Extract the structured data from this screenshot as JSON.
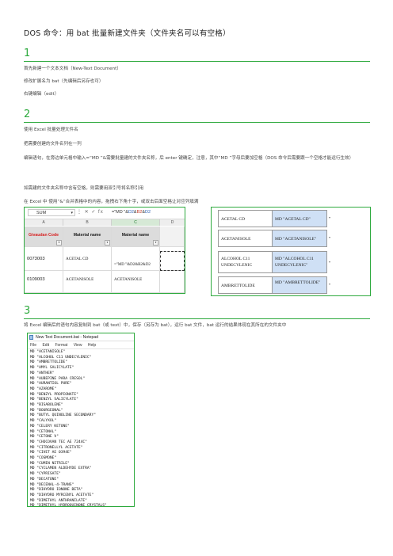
{
  "title": "DOS 命令：用 bat 批量新建文件夹（文件夹名可以有空格）",
  "sections": [
    {
      "num": "1",
      "lines": [
        "首先新建一个文本文档（New-Text Document）",
        "修改扩展名为 bat（先编辑后另存也可）",
        "右键编辑（edit）"
      ]
    },
    {
      "num": "2",
      "lines": [
        "使用 Excel 批量处理文件名",
        "把需要创建的文件名列在一列",
        "编辑语句，在旁边单元格中输入=“MD ”&需要批量建的文件夹名称，后 enter 键确定，注意，其中“MD ”字母后要加空格（DOS 命令后需要跟一个空格才能运行生效）",
        "如需建的文件夹名称中含有空格，则需要用双引号将名称引用",
        "在 Excel 中 使用“&”合并表格中的内容，拖拽右下角十字，或双击后面空格让对应列填满"
      ]
    },
    {
      "num": "3",
      "lines": [
        "将 Excel 编辑后的语句内容复制到 bat（或 text）中，保存（另存为 bat），运行 bat 文件，bat 运行的结果体现在其所在的文件夹中"
      ]
    }
  ],
  "excel": {
    "namebox": "SUM",
    "fx_icons": "⋮  ✕  ✓  fx",
    "formula_prefix": "=\"MD \"&",
    "formula_ref1": "D2",
    "formula_amp1": "&",
    "formula_ref2": "B2",
    "formula_amp2": "&",
    "formula_ref3": "D2",
    "col_headers": [
      "A",
      "B",
      "C",
      "D"
    ],
    "header_row": [
      "Givaudan Code",
      "Material name",
      "Material name",
      ""
    ],
    "rows": [
      [
        "0073003",
        "ACETAL CD",
        "",
        "=\"MD \"&D2&B2&D2"
      ],
      [
        "0109003",
        "ACETANISOLE",
        "ACETANISOLE",
        ""
      ]
    ]
  },
  "result_table": {
    "rows": [
      {
        "name": "ACETAL CD",
        "cmd": "MD \"ACETAL CD\"",
        "q": "\""
      },
      {
        "name": "ACETANISOLE",
        "cmd": "MD \"ACETANISOLE\"",
        "q": "\""
      },
      {
        "name": "ALCOHOL C11 UNDECYLENIC",
        "cmd": "MD \"ALCOHOL C11 UNDECYLENIC\"",
        "q": "\""
      },
      {
        "name": "AMBRETTOLIDE",
        "cmd": "MD \"AMBRETTOLIDE\"",
        "q": "\""
      }
    ]
  },
  "notepad": {
    "title": "New Text Document.bat - Notepad",
    "menu": [
      "File",
      "Edit",
      "Format",
      "View",
      "Help"
    ],
    "lines": [
      "MD \"ACETANISOLE\"",
      "MD \"ALCOHOL C11 UNDECYLENIC\"",
      "MD \"AMBRETTOLIDE\"",
      "MD \"AMYL SALICYLATE\"",
      "MD \"ANTHER\"",
      "MD \"AUBEPINE PARA CRESOL\"",
      "MD \"AURANTIOL PURE\"",
      "MD \"AZAROME\"",
      "MD \"BENZYL PROPIONATE\"",
      "MD \"BENZYL SALICYLATE\"",
      "MD \"BISABOLENE\"",
      "MD \"BOURGEONAL\"",
      "MD \"BUTYL QUINOLINE SECONDARY\"",
      "MD \"CALYXOL\"",
      "MD \"CELERY KETONE\"",
      "MD \"CETONAL\"",
      "MD \"CETONE V\"",
      "MD \"CHOCOVAN TEC AE 7244C\"",
      "MD \"CITRONELLYL ACETATE\"",
      "MD \"CIVET AE 0394E\"",
      "MD \"COSMONE\"",
      "MD \"CUMIN NITRILE\"",
      "MD \"CYCLAMEN ALDEHYDE EXTRA\"",
      "MD \"CYPRISATE\"",
      "MD \"DECATONE\"",
      "MD \"DECENAL-4-TRANS\"",
      "MD \"DIHYDRO IONONE BETA\"",
      "MD \"DIHYDRO MYRCENYL ACETATE\"",
      "MD \"DIMETHYL ANTHRANILATE\"",
      "MD \"DIMETHYL HYDROQUINONE CRYSTALS\"",
      "MD \"DIMETHYL OCTENONE\"",
      "MD \"DIMETOL\"",
      "MD \"DUPICAL\"",
      "MD \"EBANOL\""
    ]
  }
}
